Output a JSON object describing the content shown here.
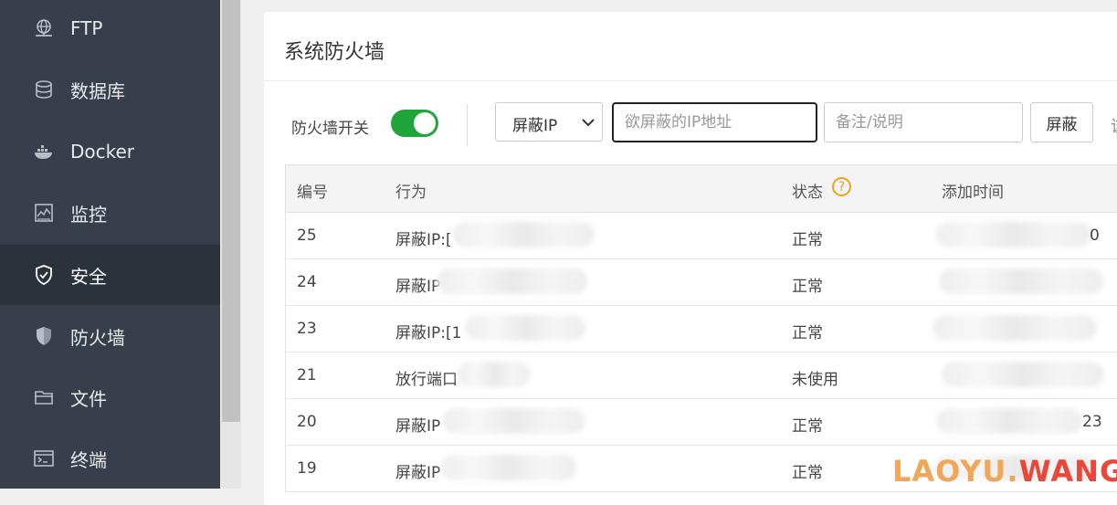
{
  "sidebar": {
    "items": [
      {
        "label": "FTP",
        "icon": "ftp-icon"
      },
      {
        "label": "数据库",
        "icon": "database-icon"
      },
      {
        "label": "Docker",
        "icon": "docker-icon"
      },
      {
        "label": "监控",
        "icon": "monitor-icon"
      },
      {
        "label": "安全",
        "icon": "shield-check-icon",
        "active": true
      },
      {
        "label": "防火墙",
        "icon": "firewall-shield-icon"
      },
      {
        "label": "文件",
        "icon": "folder-icon"
      },
      {
        "label": "终端",
        "icon": "terminal-icon"
      }
    ]
  },
  "panel": {
    "title": "系统防火墙",
    "firewall_switch_label": "防火墙开关",
    "firewall_enabled": true,
    "action_select": {
      "value": "屏蔽IP"
    },
    "ip_input": {
      "placeholder": "欲屏蔽的IP地址",
      "value": ""
    },
    "note_input": {
      "placeholder": "备注/说明",
      "value": ""
    },
    "block_button_label": "屏蔽",
    "cut_off_text": "该"
  },
  "table": {
    "headers": {
      "id": "编号",
      "action": "行为",
      "status": "状态",
      "added_time": "添加时间"
    },
    "status_help_icon": "question-circle-icon",
    "rows": [
      {
        "id": "25",
        "action": "屏蔽IP:[",
        "status": "正常",
        "time_suffix": "0"
      },
      {
        "id": "24",
        "action": "屏蔽IP",
        "status": "正常",
        "time_suffix": ""
      },
      {
        "id": "23",
        "action": "屏蔽IP:[1",
        "status": "正常",
        "time_suffix": ""
      },
      {
        "id": "21",
        "action": "放行端口",
        "status": "未使用",
        "time_suffix": ""
      },
      {
        "id": "20",
        "action": "屏蔽IP",
        "status": "正常",
        "time_suffix": "23"
      },
      {
        "id": "19",
        "action": "屏蔽IP",
        "status": "正常",
        "time_suffix": ""
      }
    ]
  },
  "watermark": {
    "part1": "LAOYU.",
    "part2": "WANG"
  },
  "colors": {
    "sidebar_bg": "#363f4a",
    "sidebar_active": "#2a323c",
    "toggle_on": "#20a53a",
    "help_icon": "#f0a020"
  }
}
